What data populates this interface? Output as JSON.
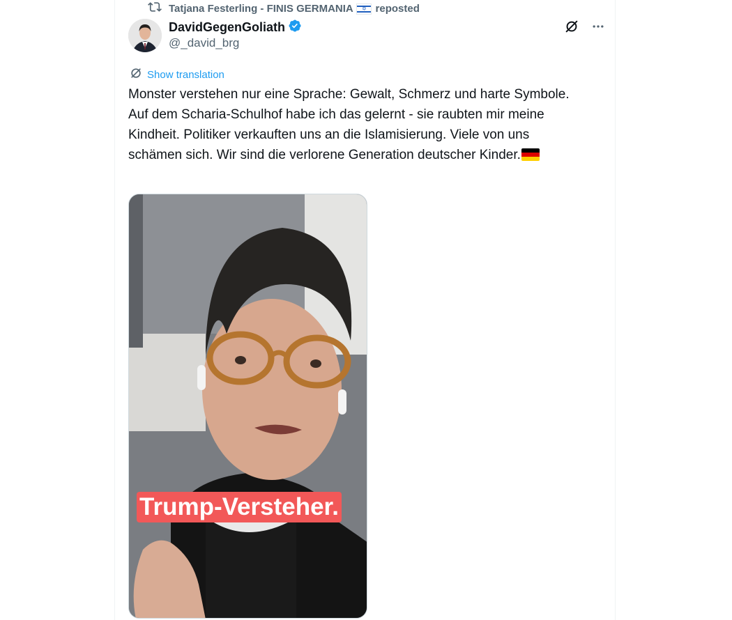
{
  "repost": {
    "reposter_name": "Tatjana Festerling - FINIS GERMANIA",
    "reposter_flag_icon": "israel-flag-icon",
    "label": "reposted"
  },
  "author": {
    "display_name": "DavidGegenGoliath",
    "handle": "@_david_brg",
    "verified": true,
    "verified_color": "#1d9bf0"
  },
  "translate": {
    "label": "Show translation"
  },
  "tweet": {
    "text": "Monster verstehen nur eine Sprache: Gewalt, Schmerz und harte Symbole. Auf dem Scharia-Schulhof habe ich das gelernt - sie raubten mir meine Kindheit. Politiker verkauften uns an die Islamisierung. Viele von uns schämen sich. Wir sind die verlorene Generation deutscher Kinder.",
    "trailing_flag_icon": "germany-flag-icon"
  },
  "media": {
    "caption": "Trump-Versteher.",
    "caption_color": "#f25858"
  },
  "colors": {
    "link": "#1d9bf0",
    "secondary_text": "#536471",
    "primary_text": "#0f1419"
  }
}
